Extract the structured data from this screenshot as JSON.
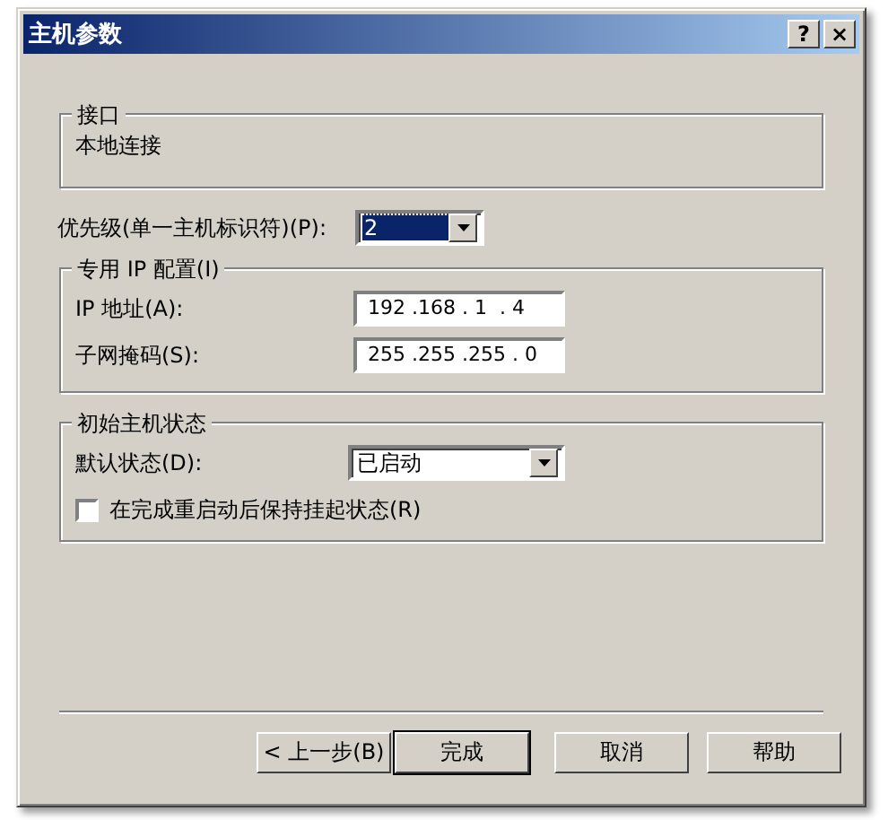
{
  "window": {
    "title": "主机参数",
    "title_buttons": [
      "?",
      "×"
    ]
  },
  "interface_group": {
    "title": "接口",
    "value": "本地连接"
  },
  "priority": {
    "label": "优先级(单一主机标识符)(P):",
    "value": "2",
    "focused": true
  },
  "ip_group": {
    "title": "专用 IP 配置(I)",
    "fields": [
      {
        "label": "IP 地址(A):",
        "value": "192 .168 . 1  . 4"
      },
      {
        "label": "子网掩码(S):",
        "value": "255 .255 .255 . 0"
      }
    ]
  },
  "state_group": {
    "title": "初始主机状态",
    "default_state": {
      "label": "默认状态(D):",
      "value": "已启动"
    },
    "checkbox": {
      "label": "在完成重启动后保持挂起状态(R)",
      "checked": false
    }
  },
  "buttons": [
    {
      "label": "< 上一步(B)",
      "default": false
    },
    {
      "label": "完成",
      "default": true
    },
    {
      "label": "取消",
      "default": false
    },
    {
      "label": "帮助",
      "default": false
    }
  ]
}
